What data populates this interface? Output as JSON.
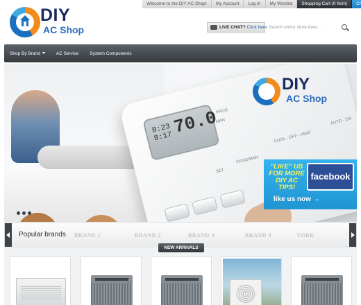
{
  "top_links": {
    "welcome": "Welcome to the DIY AC Shop!",
    "my_account": "My Account",
    "login": "Log In",
    "wishlist": "My Wishlist",
    "cart": "Shopping Cart (0 Item)",
    "checkout": "Checkout"
  },
  "logo": {
    "line1": "DIY",
    "line2": "AC Shop"
  },
  "live_chat": {
    "label": "LIVE CHAT?",
    "link": "Click here"
  },
  "search": {
    "placeholder": "Search entire store here..."
  },
  "nav": {
    "items": [
      {
        "label": "Shop By Brand",
        "has_caret": true
      },
      {
        "label": "AC Service"
      },
      {
        "label": "System Components"
      }
    ]
  },
  "hero": {
    "thermostat_temp": "70.0",
    "thermostat_small_top": "8:23",
    "thermostat_small_bottom": "8:17",
    "labels": [
      "PROG",
      "MAN",
      "COOL - OFF - HEAT",
      "AUTO - ON",
      "SET",
      "PROG/MAN"
    ],
    "logo_line1": "DIY",
    "logo_line2": "AC Shop",
    "facebook": {
      "promo": "\"LIKE\" US FOR MORE DIY AC TIPS!",
      "brand": "facebook",
      "cta": "like us now →"
    },
    "slide_count": 3
  },
  "brands": {
    "title": "Popular brands",
    "items": [
      "BRAND 1",
      "BRAND 2",
      "BRAND 3",
      "BRAND 4",
      "YORK"
    ]
  },
  "new_arrivals": {
    "label": "NEW ARRIVALS",
    "products": [
      {
        "type": "wall-unit"
      },
      {
        "type": "condenser"
      },
      {
        "type": "condenser"
      },
      {
        "type": "mini-split-photo"
      },
      {
        "type": "condenser"
      }
    ]
  },
  "colors": {
    "nav_bg": "#3e4348",
    "accent_blue": "#1f95d3",
    "brand_navy": "#1a2a5e",
    "brand_orange": "#f28c1c"
  }
}
